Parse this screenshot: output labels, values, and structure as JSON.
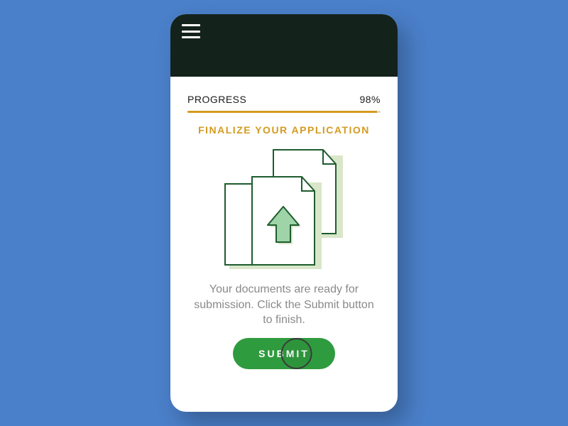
{
  "progress": {
    "label": "PROGRESS",
    "value_text": "98%",
    "value_percent": 98
  },
  "section": {
    "title": "FINALIZE YOUR APPLICATION"
  },
  "description": "Your documents are ready for submission. Click the Submit button to finish.",
  "actions": {
    "submit_label": "SUBMIT"
  },
  "colors": {
    "accent": "#d49b1f",
    "primary": "#2f9b3f",
    "header_bg": "#14221c"
  }
}
